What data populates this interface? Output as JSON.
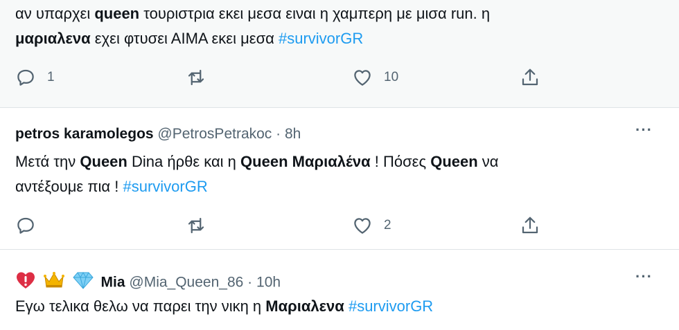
{
  "tweets": [
    {
      "body_parts": [
        {
          "text": "αν υπαρχει ",
          "style": "normal"
        },
        {
          "text": "queen",
          "style": "bold"
        },
        {
          "text": " τουριστρια εκει μεσα ειναι η χαμπερη με μισα run. η",
          "style": "normal"
        },
        {
          "text": "\n",
          "style": "br"
        },
        {
          "text": "μαριαλενα",
          "style": "bold"
        },
        {
          "text": " εχει φτυσει ΑΙΜΑ εκει μεσα ",
          "style": "normal"
        },
        {
          "text": "#survivorGR",
          "style": "hashtag"
        }
      ],
      "actions": {
        "reply_count": "1",
        "retweet_count": "",
        "like_count": "10"
      }
    },
    {
      "name": "petros karamolegos",
      "handle": "@PetrosPetrakoc",
      "sep": "·",
      "time": "8h",
      "more": "···",
      "body_parts": [
        {
          "text": "Μετά την ",
          "style": "normal"
        },
        {
          "text": "Queen",
          "style": "bold"
        },
        {
          "text": " Dina ήρθε και η ",
          "style": "normal"
        },
        {
          "text": "Queen Μαριαλένα",
          "style": "bold"
        },
        {
          "text": " ! Πόσες ",
          "style": "normal"
        },
        {
          "text": "Queen",
          "style": "bold"
        },
        {
          "text": " να",
          "style": "normal"
        },
        {
          "text": "\n",
          "style": "br"
        },
        {
          "text": "αντέξουμε πια ! ",
          "style": "normal"
        },
        {
          "text": "#survivorGR",
          "style": "hashtag"
        }
      ],
      "actions": {
        "reply_count": "",
        "retweet_count": "",
        "like_count": "2"
      }
    },
    {
      "name": "Mia",
      "emojis": [
        "heart-exclamation-icon",
        "crown-icon",
        "diamond-icon"
      ],
      "handle": "@Mia_Queen_86",
      "sep": "·",
      "time": "10h",
      "more": "···",
      "body_parts": [
        {
          "text": "Εγω τελικα θελω να παρει την νικη η ",
          "style": "normal"
        },
        {
          "text": "Μαριαλενα",
          "style": "bold"
        },
        {
          "text": " ",
          "style": "normal"
        },
        {
          "text": "#survivorGR",
          "style": "hashtag"
        }
      ]
    }
  ],
  "colors": {
    "text": "#0f1419",
    "secondary": "#536471",
    "hashtag": "#1d9bf0",
    "divider": "#dfe3e6",
    "highlight_bg": "#f7f9f9"
  }
}
